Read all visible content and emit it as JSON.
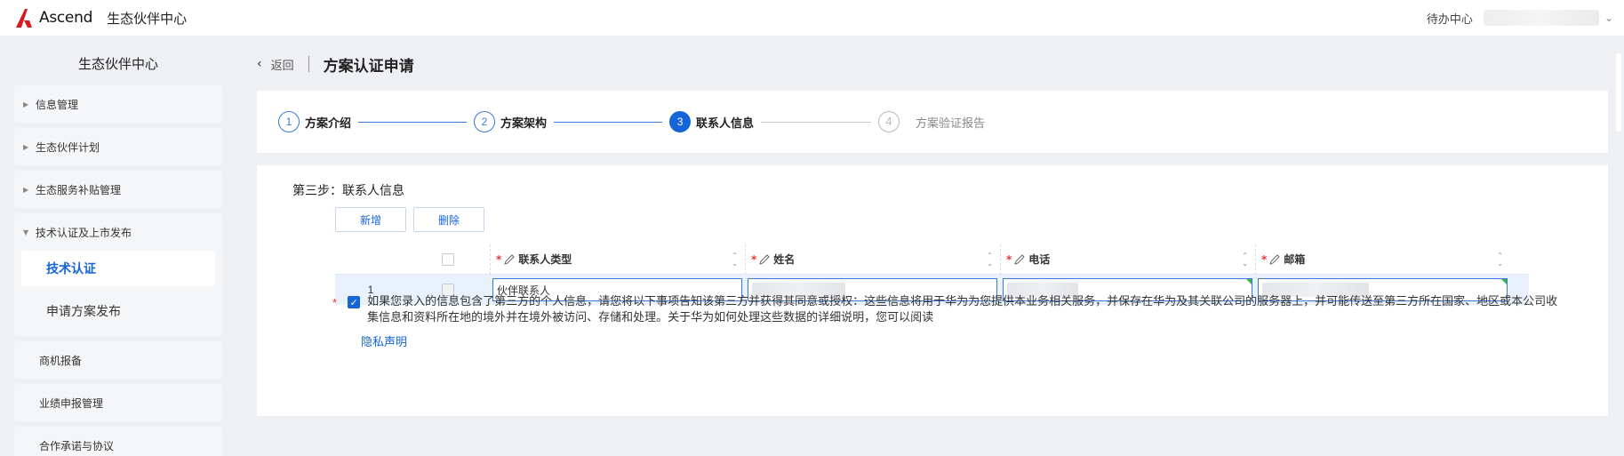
{
  "app": {
    "logo_text": "Ascend",
    "title": "生态伙伴中心",
    "todo_label": "待办中心"
  },
  "sidebar": {
    "title": "生态伙伴中心",
    "items": [
      {
        "label": "信息管理"
      },
      {
        "label": "生态伙伴计划"
      },
      {
        "label": "生态服务补贴管理"
      },
      {
        "label": "技术认证及上市发布",
        "expanded": true,
        "children": [
          {
            "label": "技术认证",
            "active": true
          },
          {
            "label": "申请方案发布"
          }
        ]
      },
      {
        "label": "商机报备"
      },
      {
        "label": "业绩申报管理"
      },
      {
        "label": "合作承诺与协议"
      }
    ]
  },
  "page": {
    "back_label": "返回",
    "title": "方案认证申请"
  },
  "steps": [
    {
      "num": "1",
      "label": "方案介绍",
      "state": "done"
    },
    {
      "num": "2",
      "label": "方案架构",
      "state": "done"
    },
    {
      "num": "3",
      "label": "联系人信息",
      "state": "current"
    },
    {
      "num": "4",
      "label": "方案验证报告",
      "state": "todo"
    }
  ],
  "form": {
    "section_title": "第三步：联系人信息",
    "add_button": "新增",
    "delete_button": "删除",
    "table": {
      "columns": [
        "联系人类型",
        "姓名",
        "电话",
        "邮箱"
      ],
      "rows": [
        {
          "index": "1",
          "contact_type": "伙伴联系人"
        }
      ]
    },
    "consent_text": "如果您录入的信息包含了第三方的个人信息，请您将以下事项告知该第三方并获得其同意或授权：这些信息将用于华为为您提供本业务相关服务，并保存在华为及其关联公司的服务器上，并可能传送至第三方所在国家、地区或本公司收集信息和资料所在地的境外并在境外被访问、存储和处理。关于华为如何处理这些数据的详细说明，您可以阅读",
    "privacy_link": "隐私声明",
    "consent_checked": true
  },
  "colors": {
    "primary": "#1565d8",
    "required": "#e53935",
    "background": "#eef0f3"
  }
}
